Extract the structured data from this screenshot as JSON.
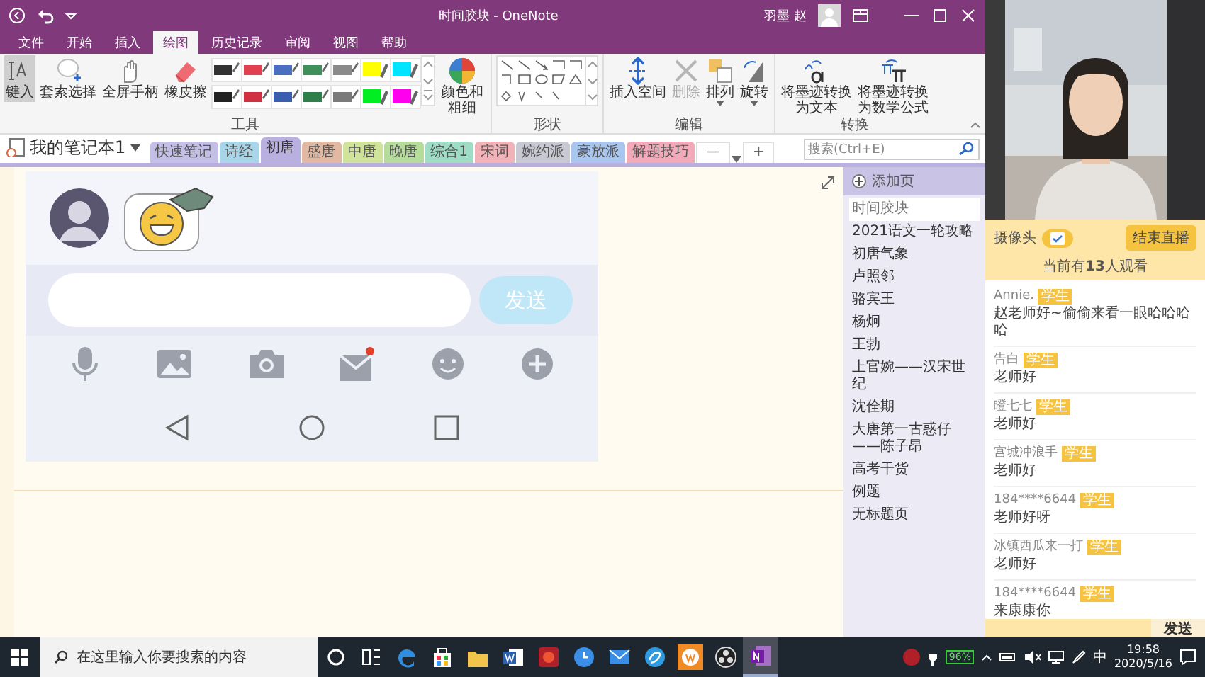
{
  "window": {
    "title": "时间胶块 - OneNote",
    "user": "羽墨 赵"
  },
  "menu": [
    {
      "label": "文件",
      "selected": false
    },
    {
      "label": "开始",
      "selected": false
    },
    {
      "label": "插入",
      "selected": false
    },
    {
      "label": "绘图",
      "selected": true
    },
    {
      "label": "历史记录",
      "selected": false
    },
    {
      "label": "审阅",
      "selected": false
    },
    {
      "label": "视图",
      "selected": false
    },
    {
      "label": "帮助",
      "selected": false
    }
  ],
  "ribbon": {
    "tools_group": {
      "label": "工具",
      "tools": [
        {
          "label": "键入",
          "kind": "type",
          "selected": true
        },
        {
          "label": "套索选择",
          "kind": "lasso",
          "selected": false
        },
        {
          "label": "全屏手柄",
          "kind": "hand",
          "selected": false
        },
        {
          "label": "橡皮擦",
          "kind": "eraser",
          "selected": false
        }
      ],
      "pens": [
        {
          "kind": "pen",
          "color": "#333333"
        },
        {
          "kind": "pen",
          "color": "#e04050"
        },
        {
          "kind": "pen",
          "color": "#4a6fc0"
        },
        {
          "kind": "pen",
          "color": "#3f8f5a"
        },
        {
          "kind": "pen",
          "color": "#8a8a8a"
        },
        {
          "kind": "highlighter",
          "color": "#ffff00"
        },
        {
          "kind": "highlighter",
          "color": "#00e5ff"
        },
        {
          "kind": "pen",
          "color": "#222222"
        },
        {
          "kind": "pen",
          "color": "#d03040"
        },
        {
          "kind": "pen",
          "color": "#3a5fb0"
        },
        {
          "kind": "pen",
          "color": "#2f7f4a"
        },
        {
          "kind": "pen",
          "color": "#7a7a7a"
        },
        {
          "kind": "highlighter",
          "color": "#00ee22"
        },
        {
          "kind": "highlighter",
          "color": "#ff00ee"
        }
      ],
      "color_label": "颜色和粗细"
    },
    "shapes_group": {
      "label": "形状"
    },
    "edit_group": {
      "label": "编辑",
      "buttons": [
        {
          "label": "插入空间",
          "kind": "insert-space",
          "disabled": false,
          "dropdown": false
        },
        {
          "label": "删除",
          "kind": "delete",
          "disabled": true,
          "dropdown": false
        },
        {
          "label": "排列",
          "kind": "arrange",
          "disabled": false,
          "dropdown": true
        },
        {
          "label": "旋转",
          "kind": "rotate",
          "disabled": false,
          "dropdown": true
        }
      ]
    },
    "convert_group": {
      "label": "转换",
      "buttons": [
        {
          "label": "将墨迹转换为文本",
          "kind": "text"
        },
        {
          "label": "将墨迹转换为数学公式",
          "kind": "math"
        }
      ]
    }
  },
  "notebook": {
    "name": "我的笔记本1"
  },
  "sections": [
    {
      "label": "快速笔记",
      "color": "#c4bfe6",
      "selected": false
    },
    {
      "label": "诗经",
      "color": "#a9d5ea",
      "selected": false
    },
    {
      "label": "初唐",
      "color": "#b9b0e0",
      "selected": true
    },
    {
      "label": "盛唐",
      "color": "#e3b8a3",
      "selected": false
    },
    {
      "label": "中唐",
      "color": "#cfe39a",
      "selected": false
    },
    {
      "label": "晚唐",
      "color": "#b5dc9a",
      "selected": false
    },
    {
      "label": "综合1",
      "color": "#9fdcc6",
      "selected": false
    },
    {
      "label": "宋词",
      "color": "#f2b3b8",
      "selected": false
    },
    {
      "label": "婉约派",
      "color": "#c9c9d3",
      "selected": false
    },
    {
      "label": "豪放派",
      "color": "#a9c6ef",
      "selected": false
    },
    {
      "label": "解题技巧",
      "color": "#f3aab8",
      "selected": false
    }
  ],
  "section_more": "—",
  "section_add": "+",
  "search": {
    "placeholder": "搜索(Ctrl+E)"
  },
  "pages": {
    "add_label": "添加页",
    "items": [
      {
        "title": "时间胶块",
        "selected": true
      },
      {
        "title": "2021语文一轮攻略",
        "selected": false
      },
      {
        "title": "初唐气象",
        "selected": false
      },
      {
        "title": "卢照邻",
        "selected": false
      },
      {
        "title": "骆宾王",
        "selected": false
      },
      {
        "title": "杨炯",
        "selected": false
      },
      {
        "title": "王勃",
        "selected": false
      },
      {
        "title": "上官婉——汉宋世纪",
        "selected": false
      },
      {
        "title": "沈佺期",
        "selected": false
      },
      {
        "title": "大唐第一古惑仔——陈子昂",
        "selected": false
      },
      {
        "title": "高考干货",
        "selected": false
      },
      {
        "title": "例题",
        "selected": false
      },
      {
        "title": "无标题页",
        "selected": false
      }
    ]
  },
  "embedded": {
    "send_label": "发送"
  },
  "live": {
    "camera_label": "摄像头",
    "camera_on": true,
    "end_button": "结束直播",
    "viewers": "当前有**13**人观看",
    "messages": [
      {
        "name": "Annie.",
        "badge": "学生",
        "text": "赵老师好~偷偷来看一眼哈哈哈哈"
      },
      {
        "name": "告白",
        "badge": "学生",
        "text": "老师好"
      },
      {
        "name": "瞪七七",
        "badge": "学生",
        "text": "老师好"
      },
      {
        "name": "宫城冲浪手",
        "badge": "学生",
        "text": "老师好"
      },
      {
        "name": "184****6644",
        "badge": "学生",
        "text": "老师好呀"
      },
      {
        "name": "冰镇西瓜来一打",
        "badge": "学生",
        "text": "老师好"
      },
      {
        "name": "184****6644",
        "badge": "学生",
        "text": "来康康你"
      }
    ],
    "send_button": "发送"
  },
  "taskbar": {
    "search_placeholder": "在这里输入你要搜索的内容",
    "apps": [
      {
        "kind": "cortana",
        "active": false
      },
      {
        "kind": "taskview",
        "active": false
      },
      {
        "kind": "edge",
        "active": false
      },
      {
        "kind": "store",
        "active": false
      },
      {
        "kind": "explorer",
        "active": false
      },
      {
        "kind": "word",
        "active": false
      },
      {
        "kind": "record",
        "active": false
      },
      {
        "kind": "clock",
        "active": false
      },
      {
        "kind": "mail",
        "active": false
      },
      {
        "kind": "browser",
        "active": false
      },
      {
        "kind": "wapp",
        "active": false
      },
      {
        "kind": "obs",
        "active": false
      },
      {
        "kind": "onenote",
        "active": true
      }
    ],
    "battery": "96%",
    "ime": "中",
    "time": "19:58",
    "date": "2020/5/16"
  }
}
